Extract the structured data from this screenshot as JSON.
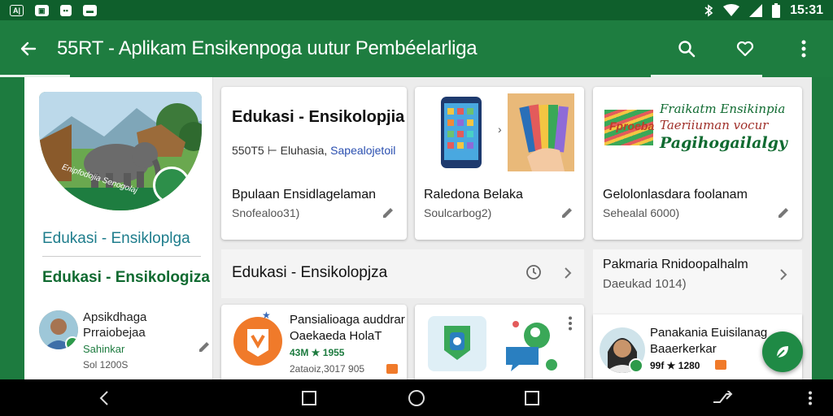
{
  "status_bar": {
    "time": "15:31",
    "left_icons": [
      "A|",
      "▣",
      "▪▪",
      "▬"
    ],
    "right_icons": [
      "bluetooth-icon",
      "wifi-icon",
      "signal-icon",
      "battery-icon"
    ]
  },
  "app_bar": {
    "title": "55RT - Aplikam Ensikenpoga uutur Pembéelarliga"
  },
  "left_panel": {
    "hero_caption": "Enipfodojia Senogolaj",
    "title1": "Edukasi - Ensikloplga",
    "title2": "Edukasi - Ensikologiza",
    "item": {
      "name_line1": "Apsikdhaga",
      "name_line2": "Prraiobejaa",
      "sub": "Sahinkar",
      "meta": "Sol 1200S"
    }
  },
  "cards": {
    "card1": {
      "title": "Edukasi - Ensikolopjia",
      "meta_prefix": "550T5 ⊢ Eluhasia,",
      "meta_link": "Sapealojetoil",
      "heading": "Bpulaan Ensidlagelaman",
      "sub": "Snofealoo31)"
    },
    "card2": {
      "heading": "Raledona Belaka",
      "sub": "Soulcarbog2)"
    },
    "card3": {
      "banner_logo": "Fproeba",
      "banner_line1": "Fraikatm Ensikinpia",
      "banner_line2": "Taeriiuman vocur",
      "banner_line3": "Pagihogailalgy",
      "heading": "Gelolonlasdara foolanam",
      "sub": "Sehealal 6000)"
    }
  },
  "section_left": {
    "title": "Edukasi - Ensikolopjza"
  },
  "section_right": {
    "title_line1": "Pakmaria Rnidoopalhalm",
    "title_line2": "Daeukad 1014)"
  },
  "bottom_cards": {
    "b1": {
      "name_line1": "Pansialioaga auddrar",
      "name_line2": "Oaekaeda HolaT",
      "stats": "43M ★ 1955",
      "meta": "2ataoiz,3017  905"
    },
    "b3": {
      "name_line1": "Panakania Euisilanag",
      "name_line2": "Baaerkerkar",
      "stats": "99f ★ 1280"
    }
  },
  "colors": {
    "primary": "#1e7d40",
    "primary_dark": "#0f5f2c",
    "accent_teal": "#1e7d8c",
    "fab": "#1f8a45"
  }
}
